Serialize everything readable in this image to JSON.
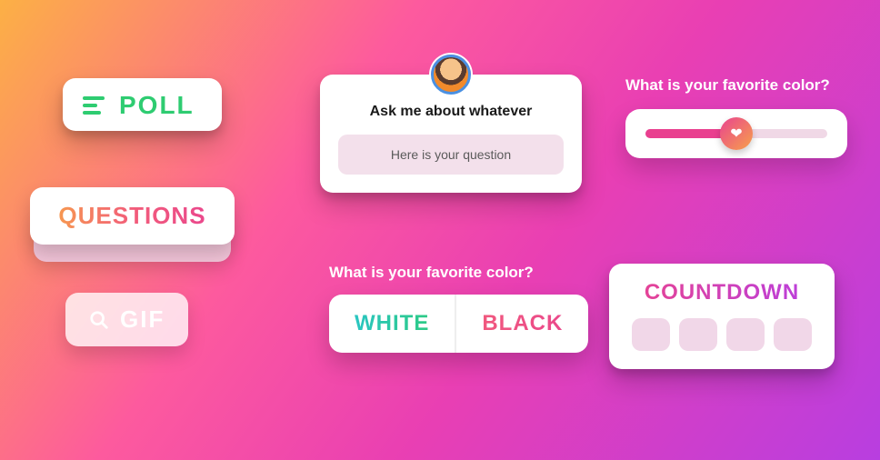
{
  "poll_sticker": {
    "label": "POLL"
  },
  "questions_sticker": {
    "label": "QUESTIONS"
  },
  "gif_sticker": {
    "label": "GIF"
  },
  "question_card": {
    "title": "Ask me about whatever",
    "placeholder": "Here is your question"
  },
  "slider_sticker": {
    "title": "What is your favorite color?",
    "value_percent": 50
  },
  "poll_options": {
    "title": "What is your favorite color?",
    "option_a": "WHITE",
    "option_b": "BLACK"
  },
  "countdown_sticker": {
    "label": "COUNTDOWN",
    "digit_slots": 4
  }
}
